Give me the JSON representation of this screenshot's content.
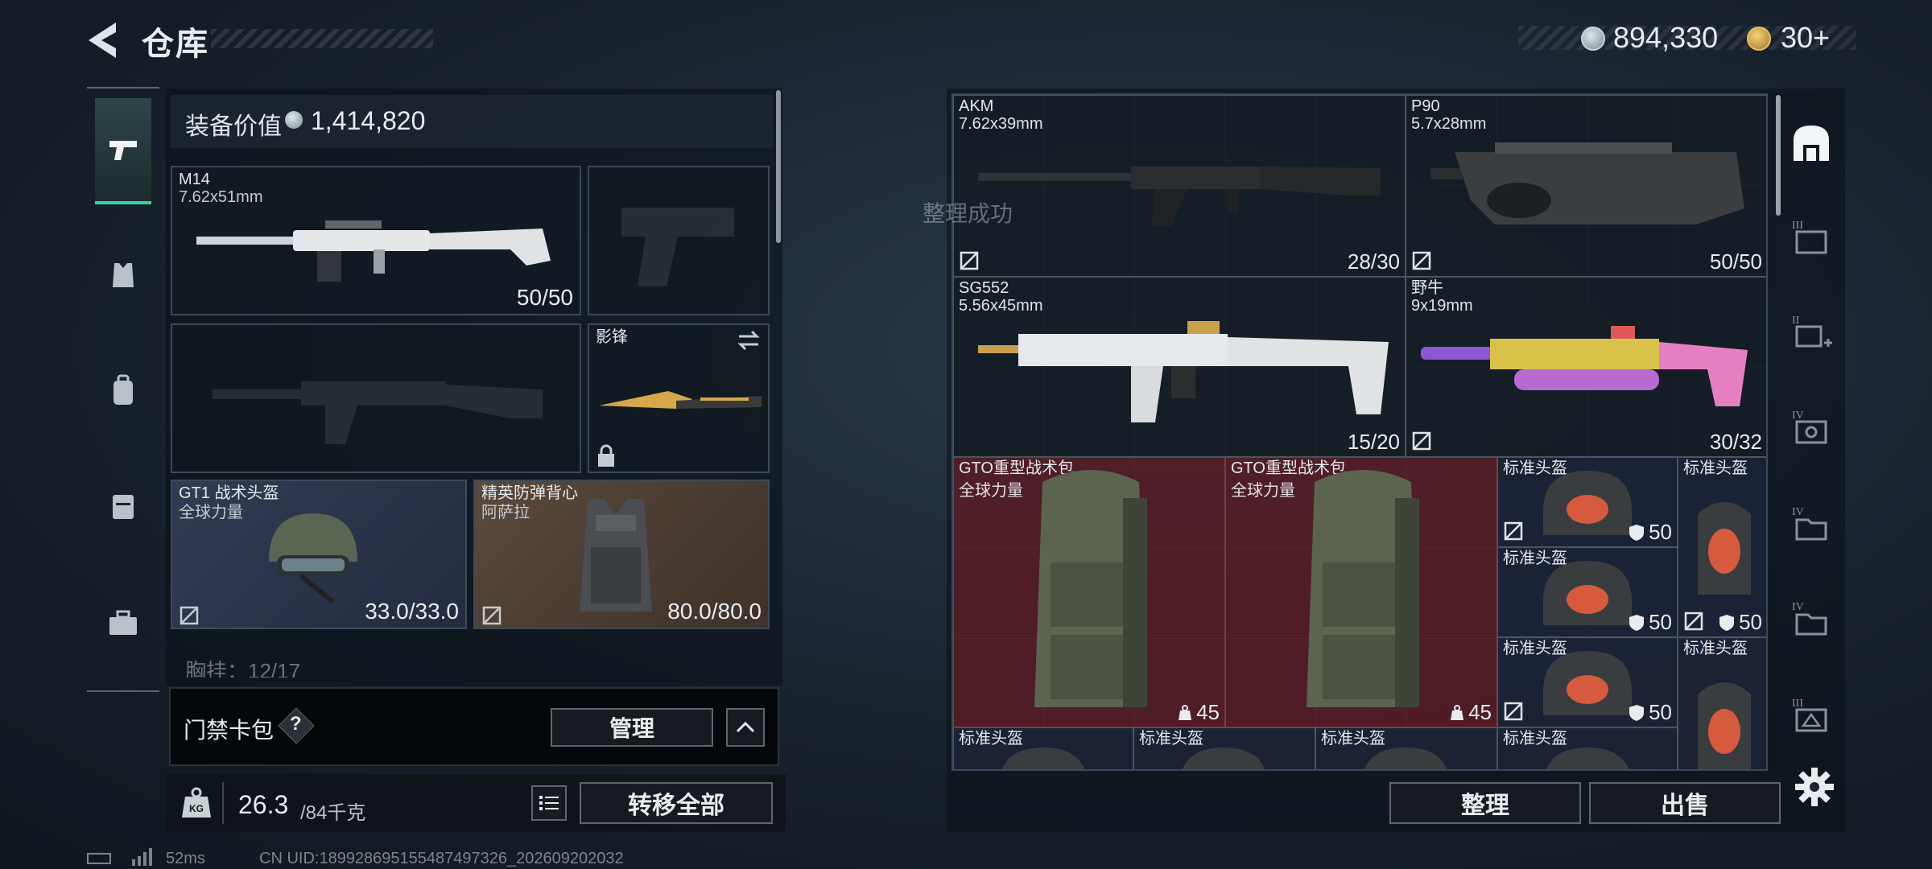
{
  "header": {
    "title": "仓库",
    "currency_value": "894,330",
    "ticket_value": "30+",
    "currency_icon": "coin-icon",
    "ticket_icon": "ticket-icon"
  },
  "categories": [
    {
      "icon": "pistol-icon",
      "active": true
    },
    {
      "icon": "armor-icon"
    },
    {
      "icon": "backpack-icon"
    },
    {
      "icon": "chest-rig-icon"
    },
    {
      "icon": "toolbox-icon"
    }
  ],
  "equipment": {
    "value_label": "装备价值",
    "value": "1,414,820",
    "primary": {
      "name": "M14",
      "caliber": "7.62x51mm",
      "ammo": "50/50"
    },
    "melee": {
      "name": "影锋"
    },
    "helmet": {
      "name": "GT1 战术头盔",
      "sub": "全球力量",
      "durability": "33.0/33.0"
    },
    "vest": {
      "name": "精英防弹背心",
      "sub": "阿萨拉",
      "durability": "80.0/80.0"
    },
    "chest_label": "胸挂：12/17"
  },
  "access_card": {
    "label": "门禁卡包",
    "help": "?",
    "manage": "管理"
  },
  "weight": {
    "current": "26.3",
    "capacity": "/84千克",
    "transfer_all": "转移全部"
  },
  "status": {
    "ping": "52ms",
    "uid": "CN UID:1899286951554874973​26_202609202032"
  },
  "toast": "整理成功",
  "warehouse": {
    "items": [
      {
        "name": "AKM",
        "sub": "7.62x39mm",
        "count": "28/30"
      },
      {
        "name": "P90",
        "sub": "5.7x28mm",
        "count": "50/50"
      },
      {
        "name": "SG552",
        "sub": "5.56x45mm",
        "count": "15/20"
      },
      {
        "name": "野牛",
        "sub": "9x19mm",
        "count": "30/32"
      },
      {
        "name": "GTO重型战术包",
        "sub": "全球力量",
        "count": "45"
      },
      {
        "name": "GTO重型战术包",
        "sub": "全球力量",
        "count": "45"
      },
      {
        "name": "标准头盔",
        "count": "50"
      },
      {
        "name": "标准头盔",
        "count": ""
      },
      {
        "name": "标准头盔",
        "count": "50"
      },
      {
        "name": "标准头盔",
        "count": "50"
      },
      {
        "name": "标准头盔",
        "count": "50"
      },
      {
        "name": "标准头盔",
        "count": ""
      },
      {
        "name": "标准头盔"
      },
      {
        "name": "标准头盔"
      },
      {
        "name": "标准头盔"
      },
      {
        "name": "标准头盔"
      }
    ],
    "sort": "整理",
    "sell": "出售"
  },
  "rail": [
    {
      "icon": "home-icon",
      "label": ""
    },
    {
      "icon": "storage-3-icon",
      "label": "III"
    },
    {
      "icon": "storage-add-2-icon",
      "label": "II"
    },
    {
      "icon": "storage-4-icon",
      "label": "IV"
    },
    {
      "icon": "storage-folder-4a-icon",
      "label": "IV"
    },
    {
      "icon": "storage-folder-4b-icon",
      "label": "IV"
    },
    {
      "icon": "storage-3b-icon",
      "label": "III"
    }
  ],
  "colors": {
    "accent": "#35d39a",
    "helmet_bg": "#2a3348",
    "vest_bg": "#4d3f33",
    "backpack_bg": "#681e28"
  }
}
